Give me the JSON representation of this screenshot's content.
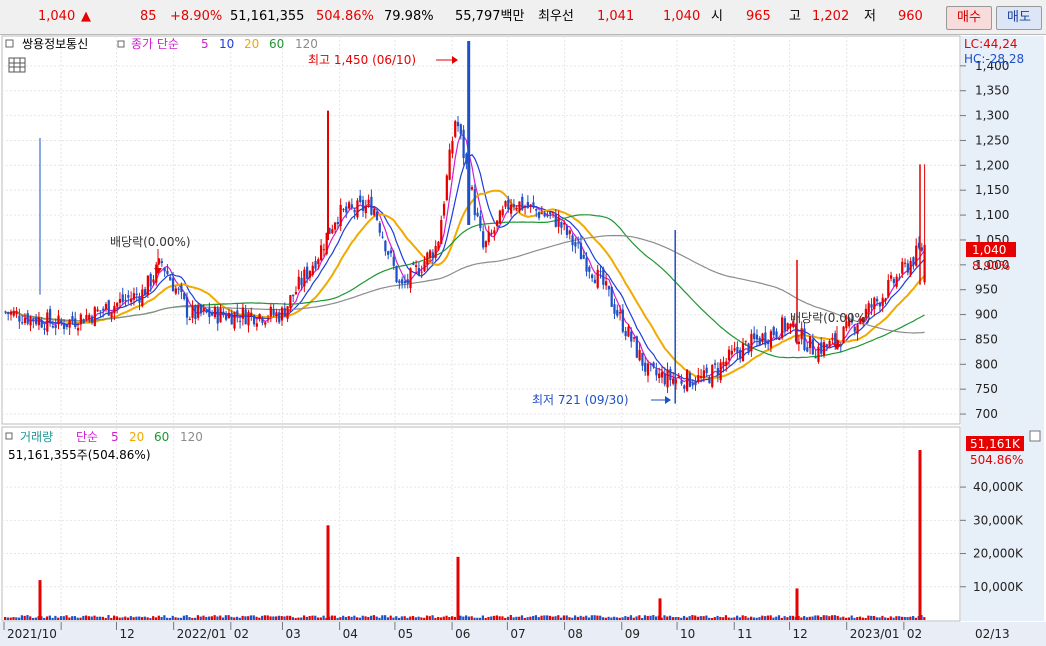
{
  "quote": {
    "price": "1,040",
    "change": "85",
    "change_pct": "+8.90%",
    "volume": "51,161,355",
    "volume_ratio": "504.86%",
    "turnover_ratio": "79.98%",
    "trade_value": "55,797백만",
    "best_label": "최우선",
    "best_ask": "1,041",
    "best_bid": "1,040",
    "open_label": "시",
    "open": "965",
    "high_label": "고",
    "high": "1,202",
    "low_label": "저",
    "low": "960",
    "buy_label": "매수",
    "sell_label": "매도"
  },
  "price_panel": {
    "stock_name": "쌍용정보통신",
    "indicator_label": "종가 단순",
    "ma_labels": [
      "5",
      "10",
      "20",
      "60",
      "120"
    ],
    "lc": "LC:44,24",
    "hc": "HC:-28,28",
    "current_price_tag": "1,040",
    "current_pct_tag": "8.90%",
    "high_annotation": "최고 1,450 (06/10)",
    "low_annotation": "최저 721 (09/30)",
    "dividend_label_1": "배당락(0.00%)",
    "dividend_label_2": "배당락(0.00%)"
  },
  "volume_panel": {
    "title": "거래량",
    "indicator_label": "단순",
    "ma_labels": [
      "5",
      "20",
      "60",
      "120"
    ],
    "summary": "51,161,355주(504.86%)",
    "current_tag": "51,161K",
    "current_pct_tag": "504.86%"
  },
  "colors": {
    "up": "#e60000",
    "down": "#1e50c8",
    "ma5": "#d21ed2",
    "ma10": "#1e3cdc",
    "ma20": "#f0aa00",
    "ma60": "#1e9632",
    "ma120": "#8c8c8c"
  },
  "chart_data": [
    {
      "type": "candlestick",
      "title": "쌍용정보통신",
      "ylim": [
        680,
        1460
      ],
      "y_ticks": [
        "1,400",
        "1,350",
        "1,300",
        "1,250",
        "1,200",
        "1,150",
        "1,100",
        "1,050",
        "1,000",
        "950",
        "900",
        "850",
        "800",
        "750",
        "700"
      ],
      "x_ticks": [
        "2021/10",
        "12",
        "2022/01",
        "02",
        "03",
        "04",
        "05",
        "06",
        "07",
        "08",
        "09",
        "10",
        "11",
        "12",
        "2023/01",
        "02",
        "02/13"
      ],
      "period": {
        "start": "2021/10/01",
        "end": "2023/02/13"
      },
      "moving_averages": [
        "5",
        "10",
        "20",
        "60",
        "120"
      ],
      "all_time_high": {
        "value": 1450,
        "date": "06/10"
      },
      "all_time_low": {
        "value": 721,
        "date": "09/30"
      },
      "last": {
        "open": 965,
        "high": 1202,
        "low": 960,
        "close": 1040,
        "change_pct": 8.9
      },
      "monthly_close_approx": [
        {
          "month": "2021/10",
          "close": 910
        },
        {
          "month": "2021/11",
          "close": 910
        },
        {
          "month": "2021/12",
          "close": 890
        },
        {
          "month": "2022/01",
          "close": 980
        },
        {
          "month": "2022/02",
          "close": 900
        },
        {
          "month": "2022/03",
          "close": 890
        },
        {
          "month": "2022/04",
          "close": 1090
        },
        {
          "month": "2022/05",
          "close": 960
        },
        {
          "month": "2022/06",
          "close": 1050
        },
        {
          "month": "2022/07",
          "close": 1100
        },
        {
          "month": "2022/08",
          "close": 990
        },
        {
          "month": "2022/09",
          "close": 800
        },
        {
          "month": "2022/10",
          "close": 770
        },
        {
          "month": "2022/11",
          "close": 790
        },
        {
          "month": "2022/12",
          "close": 850
        },
        {
          "month": "2023/01",
          "close": 870
        },
        {
          "month": "2023/02",
          "close": 1040
        }
      ]
    },
    {
      "type": "bar",
      "title": "거래량",
      "y_ticks": [
        "40,000K",
        "30,000K",
        "20,000K",
        "10,000K"
      ],
      "ylim": [
        0,
        50000
      ],
      "units": "K",
      "last_volume": 51161,
      "spikes": [
        {
          "date": "2021/10",
          "value": 12000
        },
        {
          "date": "2022/04",
          "value": 28500
        },
        {
          "date": "2022/06",
          "value": 19000
        },
        {
          "date": "2022/09",
          "value": 6500
        },
        {
          "date": "2022/12",
          "value": 9500
        },
        {
          "date": "2023/02",
          "value": 51161
        }
      ]
    }
  ]
}
